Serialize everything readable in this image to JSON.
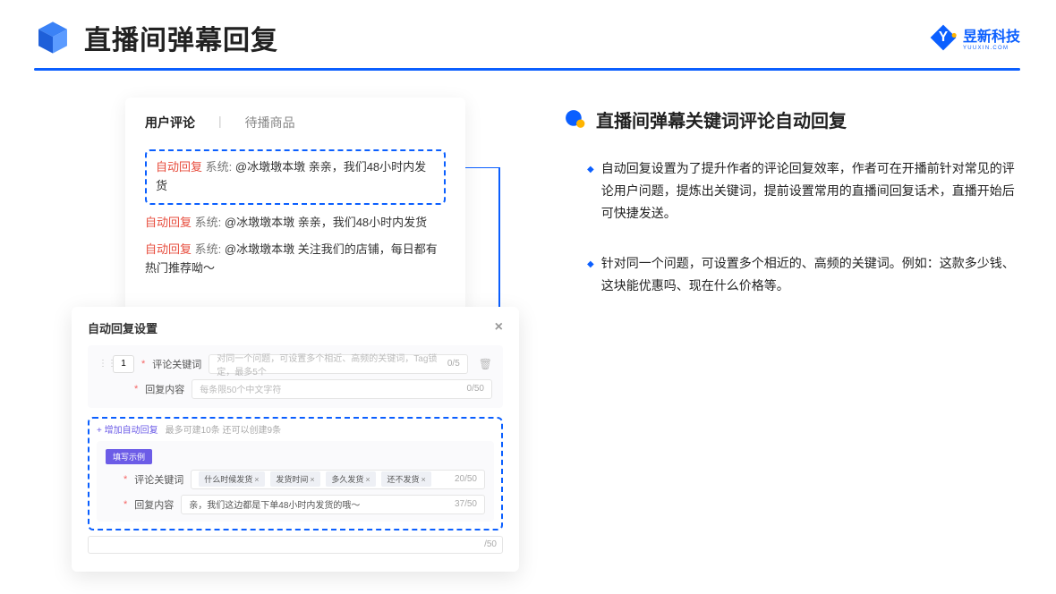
{
  "header": {
    "title": "直播间弹幕回复",
    "logo_text": "昱新科技",
    "logo_sub": "YUUXIN.COM"
  },
  "panel1": {
    "tab_active": "用户评论",
    "tab_inactive": "待播商品",
    "rows": [
      {
        "tag": "自动回复",
        "sys": "系统:",
        "text": "@冰墩墩本墩 亲亲，我们48小时内发货"
      },
      {
        "tag": "自动回复",
        "sys": "系统:",
        "text": "@冰墩墩本墩 亲亲，我们48小时内发货"
      },
      {
        "tag": "自动回复",
        "sys": "系统:",
        "text": "@冰墩墩本墩 关注我们的店铺，每日都有热门推荐呦～"
      }
    ]
  },
  "panel2": {
    "title": "自动回复设置",
    "num": "1",
    "kw_label": "评论关键词",
    "kw_placeholder": "对同一个问题，可设置多个相近、高频的关键词，Tag锁定，最多5个",
    "kw_counter": "0/5",
    "content_label": "回复内容",
    "content_placeholder": "每条限50个中文字符",
    "content_counter": "0/50",
    "add_text": "+ 增加自动回复",
    "add_hint": "最多可建10条 还可以创建9条",
    "badge": "填写示例",
    "ex_kw_label": "评论关键词",
    "ex_tags": [
      "什么时候发货",
      "发货时间",
      "多久发货",
      "还不发货"
    ],
    "ex_kw_counter": "20/50",
    "ex_content_label": "回复内容",
    "ex_content_text": "亲，我们这边都是下单48小时内发货的哦～",
    "ex_content_counter": "37/50",
    "extra_counter": "/50"
  },
  "right": {
    "title": "直播间弹幕关键词评论自动回复",
    "bullets": [
      "自动回复设置为了提升作者的评论回复效率，作者可在开播前针对常见的评论用户问题，提炼出关键词，提前设置常用的直播间回复话术，直播开始后可快捷发送。",
      "针对同一个问题，可设置多个相近的、高频的关键词。例如：这款多少钱、这块能优惠吗、现在什么价格等。"
    ]
  }
}
